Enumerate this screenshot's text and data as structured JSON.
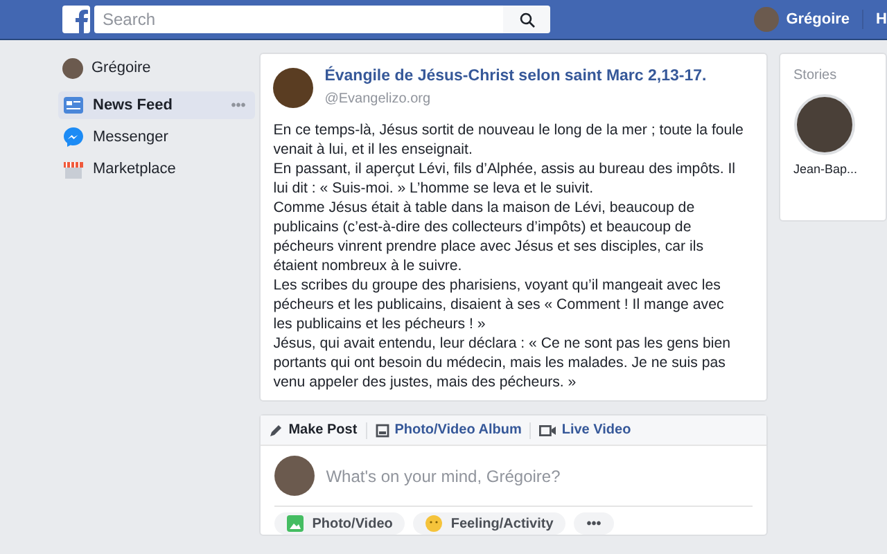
{
  "top_bar": {
    "search": {
      "placeholder": "Search"
    },
    "user": "Grégoire",
    "cut_item": "H"
  },
  "sidebar": {
    "profile": "Grégoire",
    "items": [
      {
        "label": "News Feed",
        "kind": "feed",
        "selected": true
      },
      {
        "label": "Messenger",
        "kind": "messenger",
        "selected": false
      },
      {
        "label": "Marketplace",
        "kind": "shop",
        "selected": false
      }
    ],
    "more": "•••"
  },
  "post": {
    "title": "Évangile de Jésus-Christ selon saint Marc 2,13-17.",
    "source": "@Evangelizo.org",
    "paragraphs": [
      "En ce temps-là, Jésus sortit de nouveau le long de la mer ; toute la foule venait à lui, et il les enseignait.",
      "En passant, il aperçut Lévi, fils d’Alphée, assis au bureau des impôts. Il lui dit : « Suis-moi. » L’homme se leva et le suivit.",
      "Comme Jésus était à table dans la maison de Lévi, beaucoup de publicains (c’est-à-dire des collecteurs d’impôts) et beaucoup de pécheurs vinrent prendre place avec Jésus et ses disciples, car ils étaient nombreux à le suivre.",
      "Les scribes du groupe des pharisiens, voyant qu’il mangeait avec les pécheurs et les publicains, disaient à ses « Comment ! Il mange avec les publicains et les pécheurs ! »",
      "Jésus, qui avait entendu, leur déclara : « Ce ne sont pas les gens bien portants qui ont besoin du médecin, mais les malades. Je ne suis pas venu appeler des justes, mais des pécheurs. »"
    ]
  },
  "composer": {
    "tabs": [
      {
        "label": "Make Post",
        "kind": "pencil",
        "selected": true
      },
      {
        "label": "Photo/Video Album",
        "kind": "album",
        "selected": false
      },
      {
        "label": "Live Video",
        "kind": "video",
        "selected": false
      }
    ],
    "placeholder": "What's on your mind, Grégoire?",
    "actions": [
      {
        "label": "Photo/Video",
        "kind": "photo"
      },
      {
        "label": "Feeling/Activity",
        "kind": "smile"
      },
      {
        "label": "•••",
        "kind": "more"
      }
    ]
  },
  "stories": {
    "title": "Stories",
    "items": [
      {
        "name": "Jean-Bap..."
      }
    ]
  }
}
